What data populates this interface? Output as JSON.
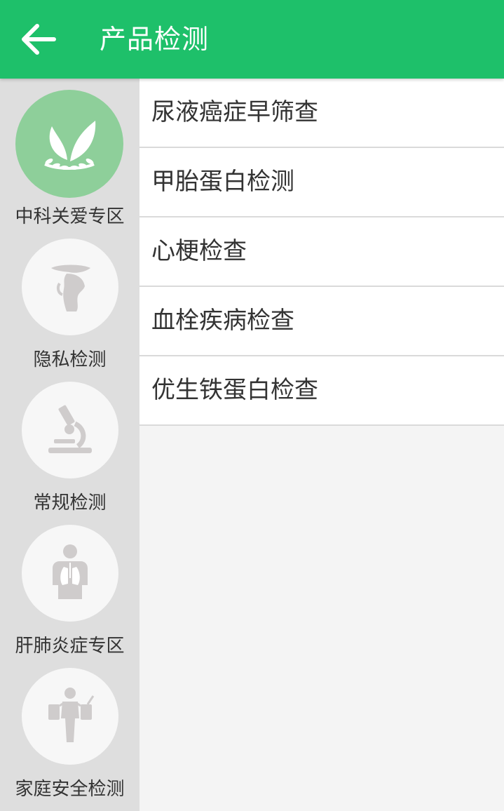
{
  "header": {
    "title": "产品检测",
    "back_icon": "arrow-left-icon",
    "background": "#1ec06a"
  },
  "sidebar": {
    "active_index": 0,
    "items": [
      {
        "label": "中科关爱专区",
        "icon": "leaf-emblem-icon"
      },
      {
        "label": "隐私检测",
        "icon": "private-body-icon"
      },
      {
        "label": "常规检测",
        "icon": "microscope-icon"
      },
      {
        "label": "肝肺炎症专区",
        "icon": "lungs-body-icon"
      },
      {
        "label": "家庭安全检测",
        "icon": "family-person-icon"
      }
    ]
  },
  "products": [
    {
      "label": "尿液癌症早筛查"
    },
    {
      "label": "甲胎蛋白检测"
    },
    {
      "label": "心梗检查"
    },
    {
      "label": "血栓疾病检查"
    },
    {
      "label": "优生铁蛋白检查"
    }
  ]
}
